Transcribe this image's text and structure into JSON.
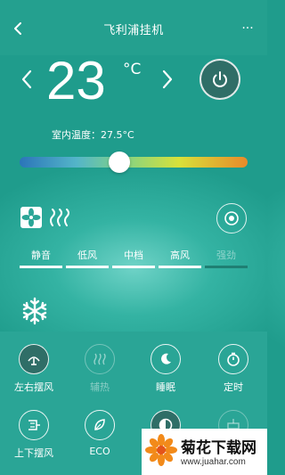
{
  "header": {
    "title": "飞利浦挂机",
    "more": "···"
  },
  "temperature": {
    "value": "23",
    "unit": "°C",
    "indoor": "室内温度：27.5°C",
    "slider_level": 0.43
  },
  "fan": {
    "speeds": [
      "静音",
      "低风",
      "中档",
      "高风",
      "强劲"
    ],
    "active_speeds": [
      true,
      true,
      true,
      true,
      false
    ]
  },
  "functions": {
    "row1": [
      "左右摆风",
      "辅热",
      "睡眠",
      "定时"
    ],
    "row2": [
      "上下摆风",
      "ECO",
      "",
      ""
    ]
  },
  "watermark": {
    "name": "菊花下载网",
    "url": "www.juahar.com"
  },
  "colors": {
    "header": "#24a08f",
    "power_fill": "#2f6e67",
    "accent": "#ffffff"
  }
}
